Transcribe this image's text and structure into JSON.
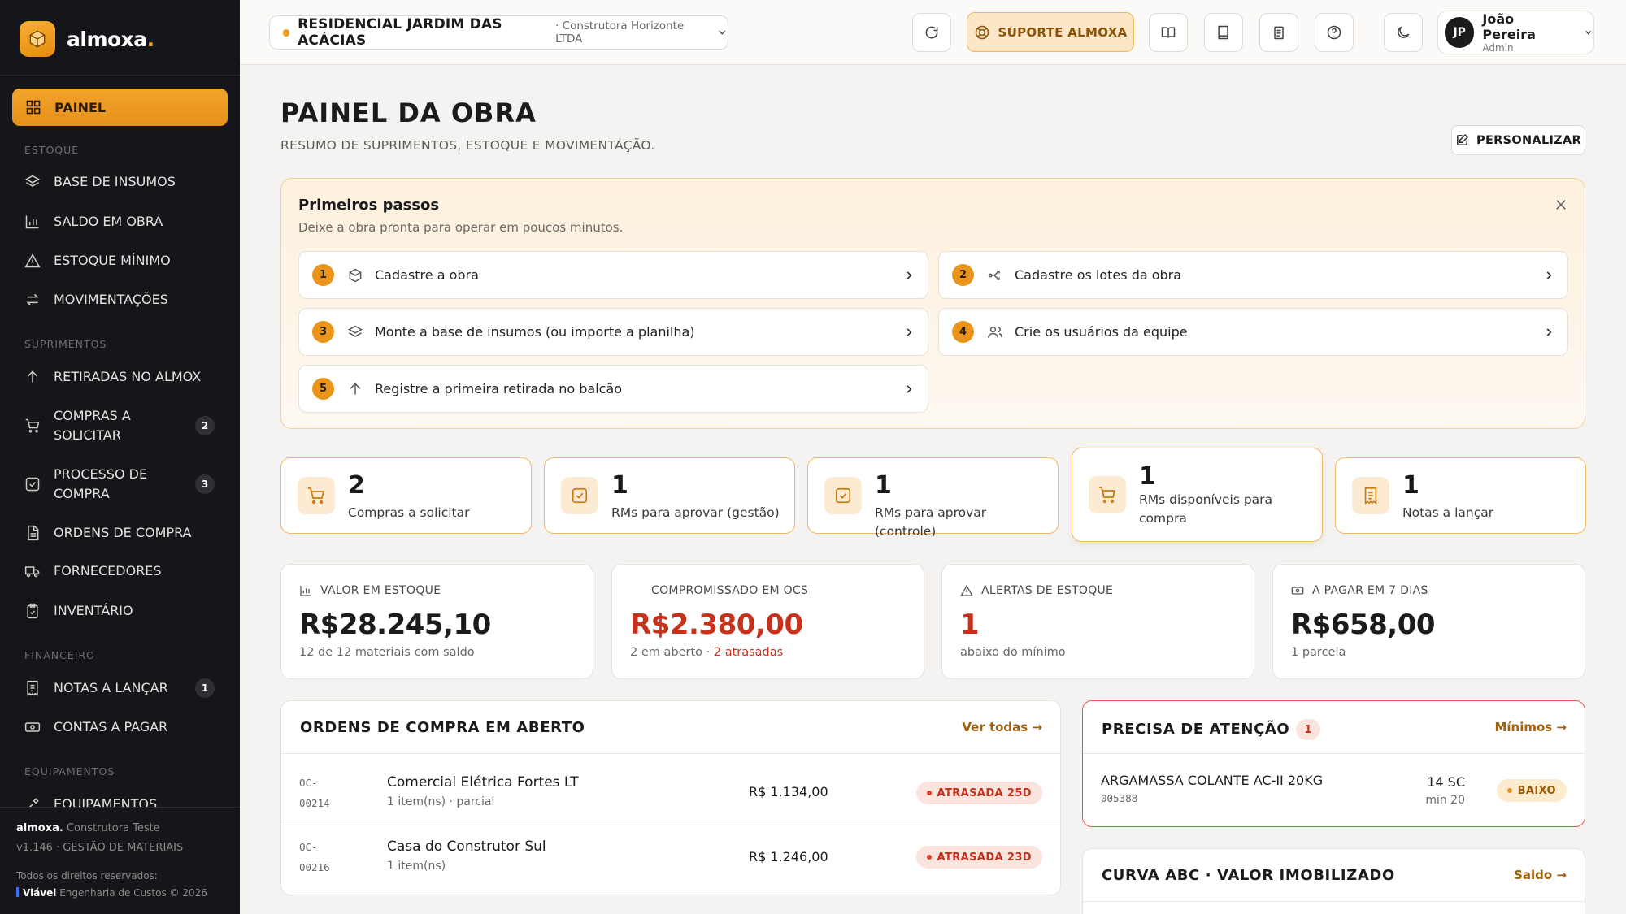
{
  "brand": {
    "name": "almoxa",
    "dot": "."
  },
  "nav": {
    "active": {
      "label": "PAINEL",
      "icon": "grid-icon"
    },
    "sections": {
      "estoque": "ESTOQUE",
      "suprimentos": "SUPRIMENTOS",
      "financeiro": "FINANCEIRO",
      "equipamentos": "EQUIPAMENTOS"
    },
    "items": {
      "base_insumos": "BASE DE INSUMOS",
      "saldo_obra": "SALDO EM OBRA",
      "estoque_minimo": "ESTOQUE MÍNIMO",
      "movimentacoes": "MOVIMENTAÇÕES",
      "retiradas": "RETIRADAS NO ALMOX",
      "compras_l1": "COMPRAS A",
      "compras_l2": "SOLICITAR",
      "compras_badge": "2",
      "processo_l1": "PROCESSO DE",
      "processo_l2": "COMPRA",
      "processo_badge": "3",
      "ordens": "ORDENS DE COMPRA",
      "fornecedores": "FORNECEDORES",
      "inventario": "INVENTÁRIO",
      "notas": "NOTAS A LANÇAR",
      "notas_badge": "1",
      "contas": "CONTAS A PAGAR",
      "equipamentos": "EQUIPAMENTOS"
    }
  },
  "footer": {
    "brand": "almoxa.",
    "company": "Construtora Teste",
    "version": "v1.146 · GESTÃO DE MATERIAIS",
    "rights": "Todos os direitos reservados:",
    "maker": "Viável",
    "maker_rest": " Engenharia de Custos © 2026"
  },
  "topbar": {
    "project": "RESIDENCIAL JARDIM DAS ACÁCIAS",
    "company": "· Construtora Horizonte LTDA",
    "support": "SUPORTE ALMOXA",
    "user": {
      "initials": "JP",
      "name": "João Pereira",
      "role": "Admin"
    }
  },
  "page": {
    "title": "PAINEL DA OBRA",
    "subtitle": "RESUMO DE SUPRIMENTOS, ESTOQUE E MOVIMENTAÇÃO.",
    "customize": "PERSONALIZAR"
  },
  "steps": {
    "title": "Primeiros passos",
    "subtitle": "Deixe a obra pronta para operar em poucos minutos.",
    "items": [
      {
        "num": "1",
        "label": "Cadastre a obra",
        "icon": "cube-icon"
      },
      {
        "num": "2",
        "label": "Cadastre os lotes da obra",
        "icon": "split-icon"
      },
      {
        "num": "3",
        "label": "Monte a base de insumos (ou importe a planilha)",
        "icon": "layers-icon"
      },
      {
        "num": "4",
        "label": "Crie os usuários da equipe",
        "icon": "users-icon"
      },
      {
        "num": "5",
        "label": "Registre a primeira retirada no balcão",
        "icon": "arrow-up-icon"
      }
    ]
  },
  "kpis": [
    {
      "value": "2",
      "label": "Compras a solicitar",
      "icon": "cart-icon"
    },
    {
      "value": "1",
      "label": "RMs para aprovar (gestão)",
      "icon": "check-square-icon"
    },
    {
      "value": "1",
      "label": "RMs para aprovar (controle)",
      "icon": "check-square-icon"
    },
    {
      "value": "1",
      "label": "RMs disponíveis para compra",
      "icon": "cart-icon"
    },
    {
      "value": "1",
      "label": "Notas a lançar",
      "icon": "receipt-icon"
    }
  ],
  "stats": [
    {
      "header": "VALOR EM ESTOQUE",
      "value": "R$28.245,10",
      "sub": "12 de 12 materiais com saldo",
      "icon": "bar-chart-icon"
    },
    {
      "header": "COMPROMISSADO EM OCS",
      "value": "R$2.380,00",
      "sub": "2 em aberto · ",
      "sub_alert": "2 atrasadas"
    },
    {
      "header": "ALERTAS DE ESTOQUE",
      "value": "1",
      "sub": "abaixo do mínimo",
      "icon": "alert-triangle-icon"
    },
    {
      "header": "A PAGAR EM 7 DIAS",
      "value": "R$658,00",
      "sub": "1 parcela",
      "icon": "banknote-icon"
    }
  ],
  "orders": {
    "title": "ORDENS DE COMPRA EM ABERTO",
    "link": "Ver todas →",
    "rows": [
      {
        "code_a": "OC-",
        "code_b": "00214",
        "supplier": "Comercial Elétrica Fortes LT",
        "meta": "1 item(ns) · parcial",
        "value": "R$ 1.134,00",
        "status": "ATRASADA 25D"
      },
      {
        "code_a": "OC-",
        "code_b": "00216",
        "supplier": "Casa do Construtor Sul",
        "meta": "1 item(ns)",
        "value": "R$ 1.246,00",
        "status": "ATRASADA 23D"
      }
    ]
  },
  "attention": {
    "title": "PRECISA DE ATENÇÃO",
    "count": "1",
    "link": "Mínimos →",
    "item": {
      "name": "ARGAMASSA COLANTE AC-II 20KG",
      "code": "005388",
      "qty": "14 SC",
      "min": "min 20",
      "status": "BAIXO"
    }
  },
  "abc": {
    "title": "CURVA ABC · VALOR IMOBILIZADO",
    "link": "Saldo →"
  },
  "colors": {
    "accent": "#E9951C",
    "sidebar": "#15161A",
    "alert": "#C4321B"
  }
}
